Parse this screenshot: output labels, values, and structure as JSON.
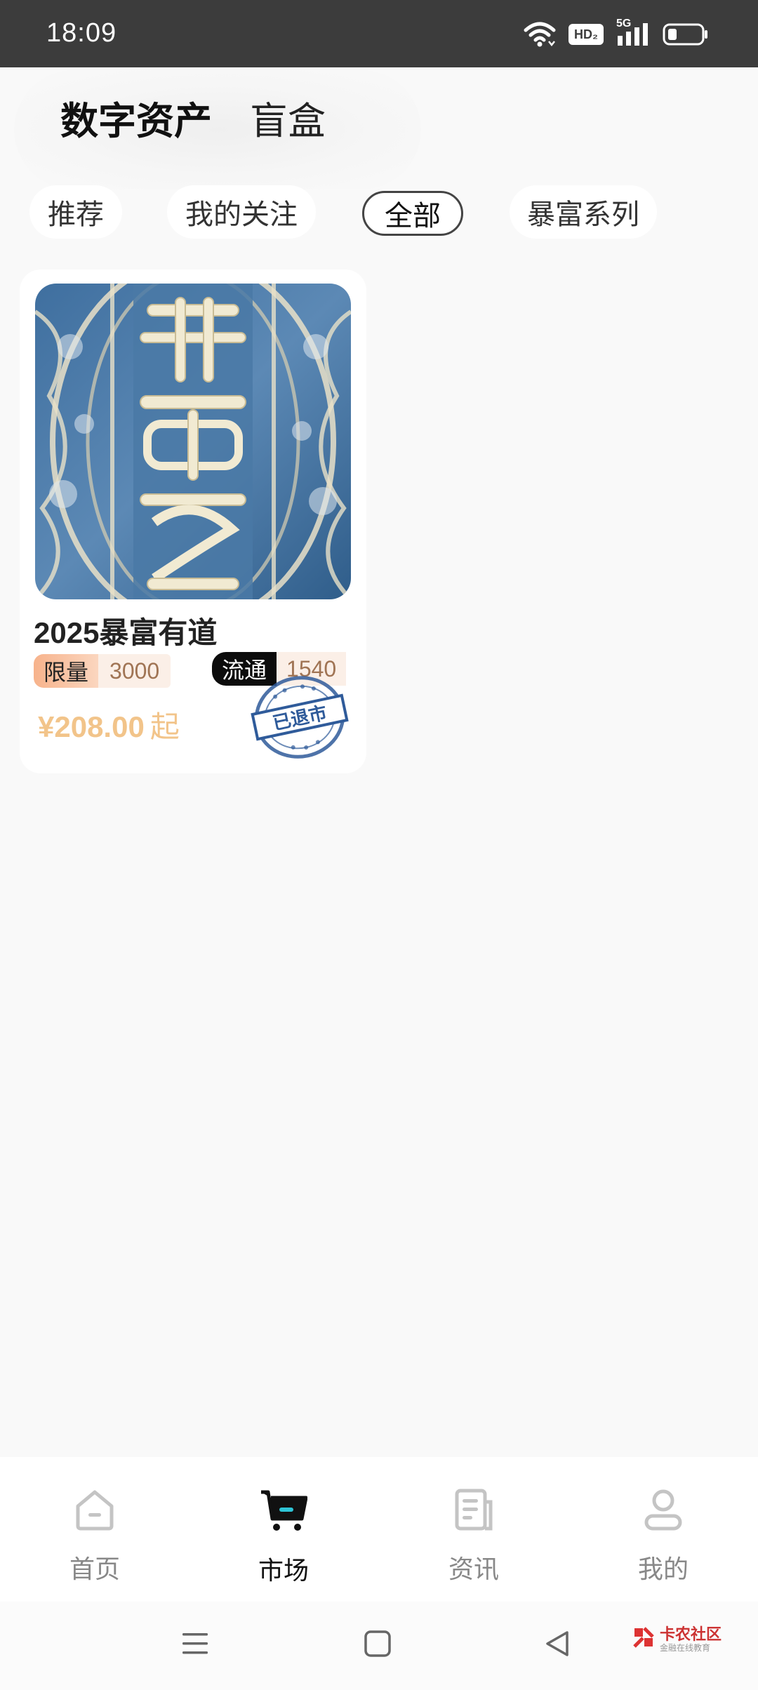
{
  "status_bar": {
    "time": "18:09",
    "hd_badge": "HD₂",
    "network": "5G",
    "icons": [
      "wifi-icon",
      "hd-voice-icon",
      "signal-5g-icon",
      "battery-icon"
    ]
  },
  "header": {
    "tabs": [
      {
        "label": "数字资产",
        "active": true
      },
      {
        "label": "盲盒",
        "active": false
      }
    ]
  },
  "filters": {
    "chips": [
      "推荐",
      "我的关注",
      "全部",
      "暴富系列"
    ],
    "selected": "全部"
  },
  "products": [
    {
      "title": "2025暴富有道",
      "limit_label": "限量",
      "limit_value": "3000",
      "circulation_label": "流通",
      "circulation_value": "1540",
      "price": "¥208.00",
      "price_suffix": "起",
      "stamp_text": "已退市",
      "art_text": "暴富有道"
    }
  ],
  "bottom_nav": {
    "items": [
      {
        "label": "首页",
        "icon": "home-icon",
        "active": false
      },
      {
        "label": "市场",
        "icon": "cart-icon",
        "active": true
      },
      {
        "label": "资讯",
        "icon": "news-icon",
        "active": false
      },
      {
        "label": "我的",
        "icon": "profile-icon",
        "active": false
      }
    ]
  },
  "watermark": {
    "main": "卡农社区",
    "sub": "金融在线教育"
  },
  "colors": {
    "accent_orange": "#f6a982",
    "price": "#f2c48a",
    "tag_value": "#a07454",
    "status_bar": "#3c3c3c",
    "cart_accent": "#2ec4d6"
  }
}
